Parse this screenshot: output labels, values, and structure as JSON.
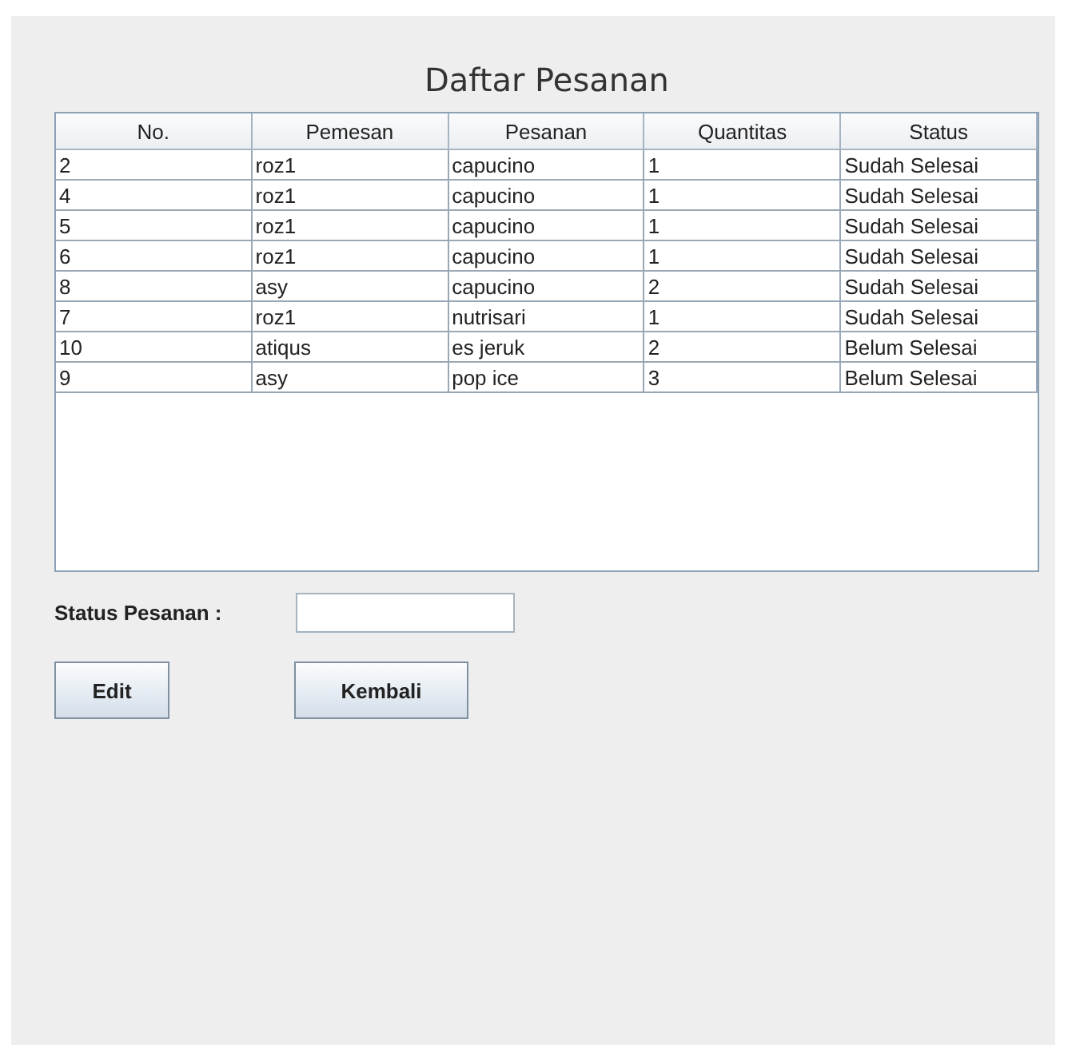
{
  "title": "Daftar Pesanan",
  "table": {
    "columns": [
      "No.",
      "Pemesan",
      "Pesanan",
      "Quantitas",
      "Status"
    ],
    "rows": [
      [
        "2",
        "roz1",
        "capucino",
        "1",
        "Sudah Selesai"
      ],
      [
        "4",
        "roz1",
        "capucino",
        "1",
        "Sudah Selesai"
      ],
      [
        "5",
        "roz1",
        "capucino",
        "1",
        "Sudah Selesai"
      ],
      [
        "6",
        "roz1",
        "capucino",
        "1",
        "Sudah Selesai"
      ],
      [
        "8",
        "asy",
        "capucino",
        "2",
        "Sudah Selesai"
      ],
      [
        "7",
        "roz1",
        "nutrisari",
        "1",
        "Sudah Selesai"
      ],
      [
        "10",
        "atiqus",
        "es jeruk",
        "2",
        "Belum Selesai"
      ],
      [
        "9",
        "asy",
        "pop ice",
        "3",
        "Belum Selesai"
      ]
    ]
  },
  "status_field": {
    "label": "Status Pesanan :"
  },
  "buttons": [
    "Edit",
    "Kembali"
  ]
}
